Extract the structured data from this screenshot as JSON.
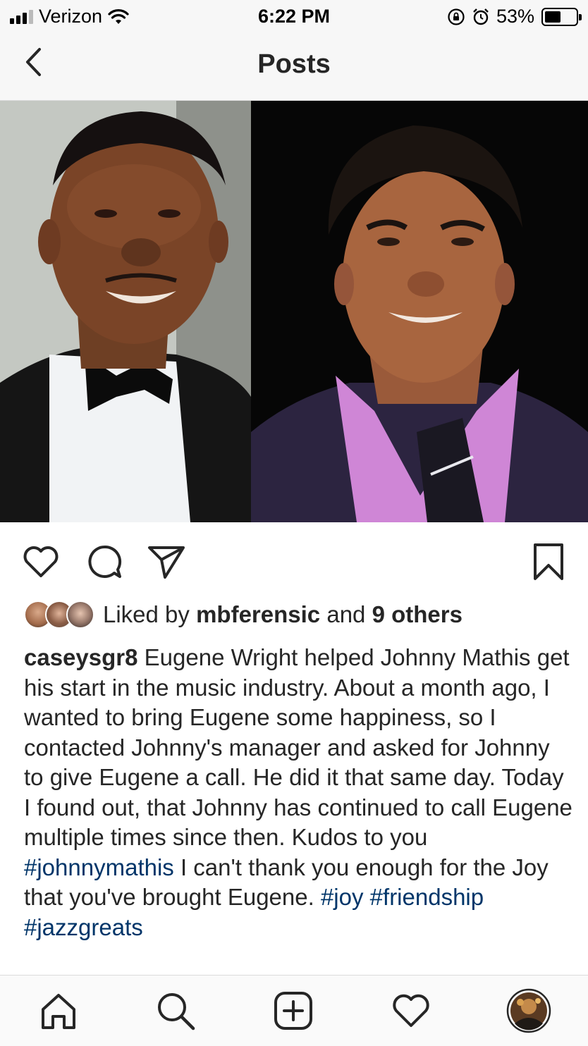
{
  "status_bar": {
    "carrier": "Verizon",
    "time": "6:22 PM",
    "battery_percent": "53%",
    "battery_level": 0.53
  },
  "header": {
    "title": "Posts"
  },
  "post": {
    "likes": {
      "prefix": "Liked by",
      "user": "mbferensic",
      "connector": "and",
      "others": "9 others"
    },
    "caption": {
      "username": "caseysgr8",
      "text_1": " Eugene Wright helped Johnny Mathis get his start in the music industry. About a month ago, I wanted to bring Eugene some happiness, so I contacted Johnny's manager and asked for Johnny to give Eugene a call.  He did it that same day.  Today I found out, that Johnny has continued to call Eugene multiple times since then.  Kudos to you ",
      "hashtag_1": "#johnnymathis",
      "text_2": " I can't thank you enough for the Joy that you've brought Eugene. ",
      "hashtag_2": "#joy",
      "hashtag_3": "#friendship",
      "hashtag_4": "#jazzgreats"
    }
  },
  "colors": {
    "hashtag": "#003569",
    "text": "#262626",
    "bar_background": "#f7f7f7"
  },
  "icons": {
    "back": "chevron-left-icon",
    "like": "heart-icon",
    "comment": "comment-icon",
    "share": "send-icon",
    "save": "bookmark-icon",
    "tab_home": "home-icon",
    "tab_search": "search-icon",
    "tab_new_post": "add-post-icon",
    "tab_activity": "heart-icon",
    "tab_profile": "profile-avatar"
  }
}
